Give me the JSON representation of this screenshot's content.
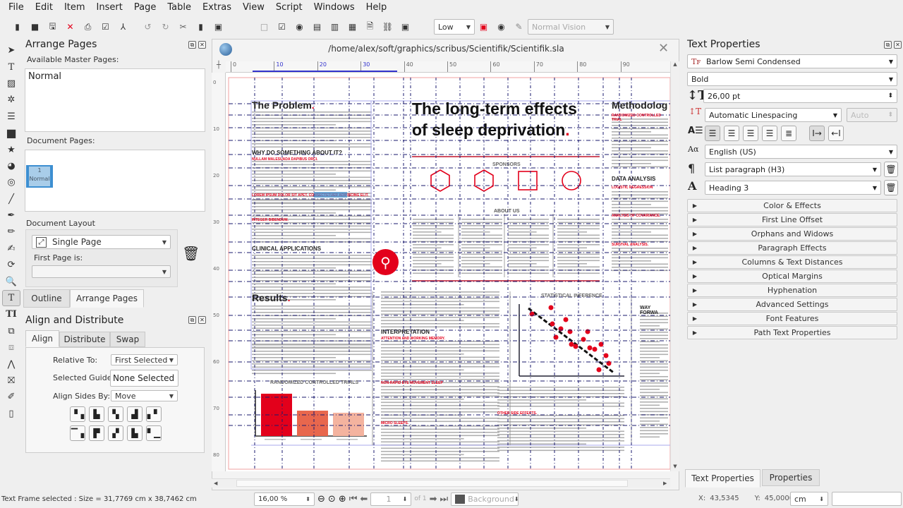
{
  "menubar": {
    "items": [
      "File",
      "Edit",
      "Item",
      "Insert",
      "Page",
      "Table",
      "Extras",
      "View",
      "Script",
      "Windows",
      "Help"
    ]
  },
  "toolbar": {
    "icons": [
      "new-icon",
      "open-icon",
      "save-icon",
      "close-icon",
      "print-icon",
      "preflight-icon",
      "pdf-export-icon",
      "undo-icon",
      "redo-icon",
      "cut-icon",
      "copy-icon",
      "paste-icon",
      "pdf-push-button-icon",
      "pdf-checkbox-icon",
      "pdf-radio-icon",
      "pdf-text-field-icon",
      "pdf-combo-icon",
      "pdf-list-box-icon",
      "text-annotation-icon",
      "link-annotation-icon",
      "3d-annotation-icon"
    ],
    "preview_quality": "Low",
    "vision_mode": "Normal Vision"
  },
  "tools": [
    "select",
    "text-frame",
    "image-frame",
    "render-frame",
    "table",
    "shape",
    "polygon",
    "arc",
    "spiral",
    "line",
    "bezier",
    "freehand",
    "calligraphic",
    "rotate",
    "zoom",
    "edit-contents",
    "edit-text",
    "link-frames",
    "unlink-frames",
    "measure",
    "copy-properties",
    "eyedropper",
    "pdf-tools"
  ],
  "arrange_pages": {
    "title": "Arrange Pages",
    "master_label": "Available Master Pages:",
    "masters": [
      "Normal"
    ],
    "doc_pages_label": "Document Pages:",
    "page_thumb": {
      "number": "1",
      "master": "Normal"
    },
    "layout_label": "Document Layout",
    "layout_value": "Single Page",
    "first_page_label": "First Page is:",
    "first_page_value": ""
  },
  "left_tabs": [
    "Outline",
    "Arrange Pages"
  ],
  "align": {
    "title": "Align and Distribute",
    "tabs": [
      "Align",
      "Distribute",
      "Swap"
    ],
    "relative_label": "Relative To:",
    "relative_value": "First Selected",
    "guide_label": "Selected Guide:",
    "guide_value": "None Selected",
    "sides_label": "Align Sides By:",
    "sides_value": "Move"
  },
  "document": {
    "path": "/home/alex/soft/graphics/scribus/Scientifik/Scientifik.sla",
    "ruler_h": [
      "0",
      "10",
      "20",
      "30",
      "40",
      "50",
      "60",
      "70",
      "80",
      "90"
    ],
    "ruler_v": [
      "0",
      "10",
      "20",
      "30",
      "40",
      "50",
      "60",
      "70",
      "80"
    ],
    "page": {
      "problem_heading": "The Problem",
      "title_line1": "The long-term effects",
      "title_line2": "of sleep deprivation",
      "methodology": "Methodolog",
      "why": "WHY DO SOMETHING ABOUT IT?",
      "clinical": "CLINICAL APPLICATIONS",
      "sponsors": "SPONSORS",
      "about": "ABOUT US",
      "data_analysis": "DATA ANALYSIS",
      "results": "Results",
      "interpretation": "INTERPRETATION",
      "trials": "RANDOMIZED CONTROLLED TRIALS",
      "inference": "STATISTICAL INFERENCE",
      "way_forward": "WAY FORWA",
      "red1": "NULLAM MALESUADA DAPIBUS ORCI.",
      "red2": "LOREM IPSUM DOLOR SIT APET, CONSECTETUER ADIPISCING ELIT.",
      "red3": "INTEGER BIBENDUM.",
      "red4": "RANDOMIZED CONTROLLED TRIAL",
      "red5": "LOGISTIC REGRESSION",
      "red6": "ANALYSIS OF COVARIANCE.",
      "red7": "SURVIVAL ANALYSIS.",
      "red8": "ATTENTION AND WORKING MEMORY.",
      "red9": "NON-RAPID EYE MOVEMENT SLEEP",
      "red10": "MICRO SLEEPS.",
      "red11": "OTHER SIDE EFFECTS.",
      "bar_values": [
        1.0,
        0.6,
        0.55
      ],
      "bar_colors": [
        "#e3001b",
        "#e8674d",
        "#f4b39f"
      ]
    }
  },
  "bottom_bar": {
    "zoom": "16,00 %",
    "page": "1",
    "of": "of 1",
    "layer": "Background"
  },
  "text_properties": {
    "title": "Text Properties",
    "font": "Barlow Semi Condensed",
    "style": "Bold",
    "size": "26,00 pt",
    "linespacing": "Automatic Linespacing",
    "linespacing_value": "Auto",
    "language": "English (US)",
    "para_style": "List paragraph (H3)",
    "char_style": "Heading 3",
    "sections": [
      "Color & Effects",
      "First Line Offset",
      "Orphans and Widows",
      "Paragraph Effects",
      "Columns & Text Distances",
      "Optical Margins",
      "Hyphenation",
      "Advanced Settings",
      "Font Features",
      "Path Text Properties"
    ]
  },
  "right_tabs": [
    "Text Properties",
    "Properties"
  ],
  "status": {
    "message": "Text Frame selected : Size = 31,7769 cm x 38,7462 cm",
    "x_label": "X:",
    "x": "43,5345",
    "y_label": "Y:",
    "y": "45,0000",
    "unit": "cm"
  },
  "colors": {
    "accent_red": "#e3001b",
    "selection_blue": "#3d8fd1"
  }
}
